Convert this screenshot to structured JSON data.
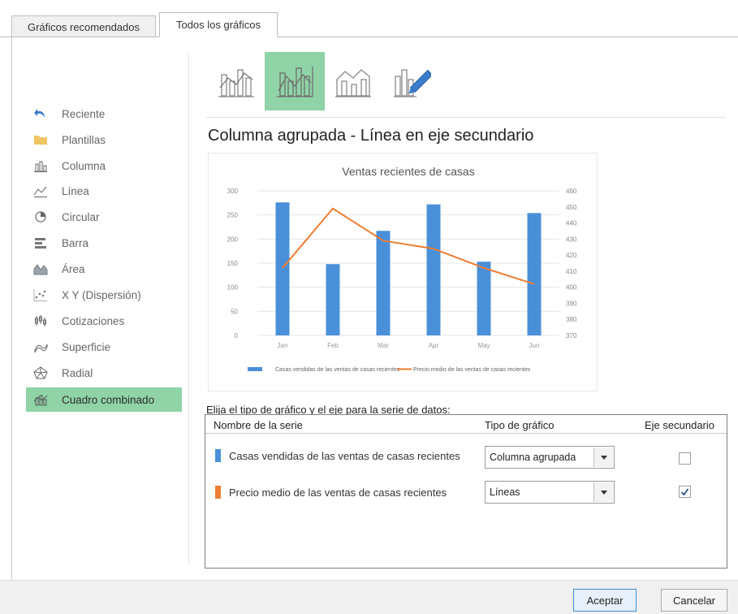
{
  "tabs": [
    {
      "label": "Gráficos recomendados"
    },
    {
      "label": "Todos los gráficos"
    }
  ],
  "sidebar": {
    "items": [
      {
        "label": "Reciente",
        "icon": "undo-arrow-icon"
      },
      {
        "label": "Plantillas",
        "icon": "folder-icon"
      },
      {
        "label": "Columna",
        "icon": "column-chart-icon"
      },
      {
        "label": "Línea",
        "icon": "line-chart-icon"
      },
      {
        "label": "Circular",
        "icon": "pie-chart-icon"
      },
      {
        "label": "Barra",
        "icon": "bar-chart-icon"
      },
      {
        "label": "Área",
        "icon": "area-chart-icon"
      },
      {
        "label": "X Y (Dispersión)",
        "icon": "scatter-chart-icon"
      },
      {
        "label": "Cotizaciones",
        "icon": "stock-chart-icon"
      },
      {
        "label": "Superficie",
        "icon": "surface-chart-icon"
      },
      {
        "label": "Radial",
        "icon": "radar-chart-icon"
      },
      {
        "label": "Cuadro combinado",
        "icon": "combo-chart-icon"
      }
    ],
    "selected_index": 11
  },
  "combo_types": {
    "icons": [
      "combo-column-line-icon",
      "combo-column-line-secondary-icon",
      "combo-area-column-icon",
      "combo-custom-icon"
    ],
    "selected_index": 1
  },
  "subtitle": "Columna agrupada - Línea en eje secundario",
  "chart_data": {
    "type": "bar",
    "title": "Ventas recientes de casas",
    "categories": [
      "Jan",
      "Feb",
      "Mar",
      "Apr",
      "May",
      "Jun"
    ],
    "series": [
      {
        "name": "Casas vendidas de las ventas de casas recientes",
        "type": "column",
        "axis": "primary",
        "color": "#4a90d9",
        "values": [
          276,
          148,
          217,
          272,
          153,
          254
        ]
      },
      {
        "name": "Precio medio de las ventas de casas recientes",
        "type": "line",
        "axis": "secondary",
        "color": "#ed7d31",
        "values": [
          412,
          449,
          429,
          424,
          412,
          402
        ]
      }
    ],
    "ylim": [
      0,
      300
    ],
    "y_ticks": [
      "0",
      "50",
      "100",
      "150",
      "200",
      "250",
      "300"
    ],
    "y2lim": [
      370,
      460
    ],
    "y2_ticks": [
      "370",
      "380",
      "390",
      "400",
      "410",
      "420",
      "430",
      "440",
      "450",
      "460"
    ],
    "ylabel": "",
    "legend": "bottom",
    "grid": true
  },
  "series_section": {
    "label": "Elija el tipo de gráfico y el eje para la serie de datos:",
    "headers": {
      "name": "Nombre de la serie",
      "type": "Tipo de gráfico",
      "secondary": "Eje secundario"
    },
    "rows": [
      {
        "name": "Casas vendidas de las ventas de casas recientes",
        "color": "#4a90d9",
        "chart_type": "Columna agrupada",
        "secondary": false
      },
      {
        "name": "Precio medio de las ventas de casas recientes",
        "color": "#ed7d31",
        "chart_type": "Líneas",
        "secondary": true
      }
    ]
  },
  "footer": {
    "ok": "Aceptar",
    "cancel": "Cancelar"
  }
}
